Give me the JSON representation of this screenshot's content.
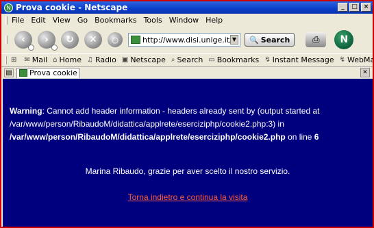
{
  "window": {
    "title": "Prova cookie - Netscape",
    "controls": [
      "_",
      "□",
      "×"
    ]
  },
  "menu": [
    "File",
    "Edit",
    "View",
    "Go",
    "Bookmarks",
    "Tools",
    "Window",
    "Help"
  ],
  "navbar": {
    "url": "http://www.disi.unige.it/persor",
    "search_label": "Search"
  },
  "personal_toolbar": {
    "items": [
      {
        "icon": "home-tab-icon",
        "label": ""
      },
      {
        "icon": "mail-icon",
        "label": "Mail"
      },
      {
        "icon": "home-icon",
        "label": "Home"
      },
      {
        "icon": "radio-icon",
        "label": "Radio"
      },
      {
        "icon": "netscape-icon",
        "label": "Netscape"
      },
      {
        "icon": "search-icon",
        "label": "Search"
      },
      {
        "icon": "bookmarks-icon",
        "label": "Bookmarks"
      },
      {
        "icon": "instant-message-icon",
        "label": "Instant Message"
      },
      {
        "icon": "webmail-icon",
        "label": "WebMa"
      }
    ]
  },
  "tab": {
    "label": "Prova cookie"
  },
  "content": {
    "background": "#00007f",
    "warning_label": "Warning",
    "warning_line1": ": Cannot add header information - headers already sent by (output started at",
    "warning_line2": "/var/www/person/RibaudoM/didattica/applrete/eserciziphp/cookie2.php:3) in",
    "warning_path": "/var/www/person/RibaudoM/didattica/applrete/eserciziphp/cookie2.php",
    "warning_online": " on line ",
    "warning_line_no": "6",
    "thanks": "Marina Ribaudo, grazie per aver scelto il nostro servizio.",
    "back_link": "Torna indietro e continua la visita",
    "link_color": "#ff5a3c"
  }
}
